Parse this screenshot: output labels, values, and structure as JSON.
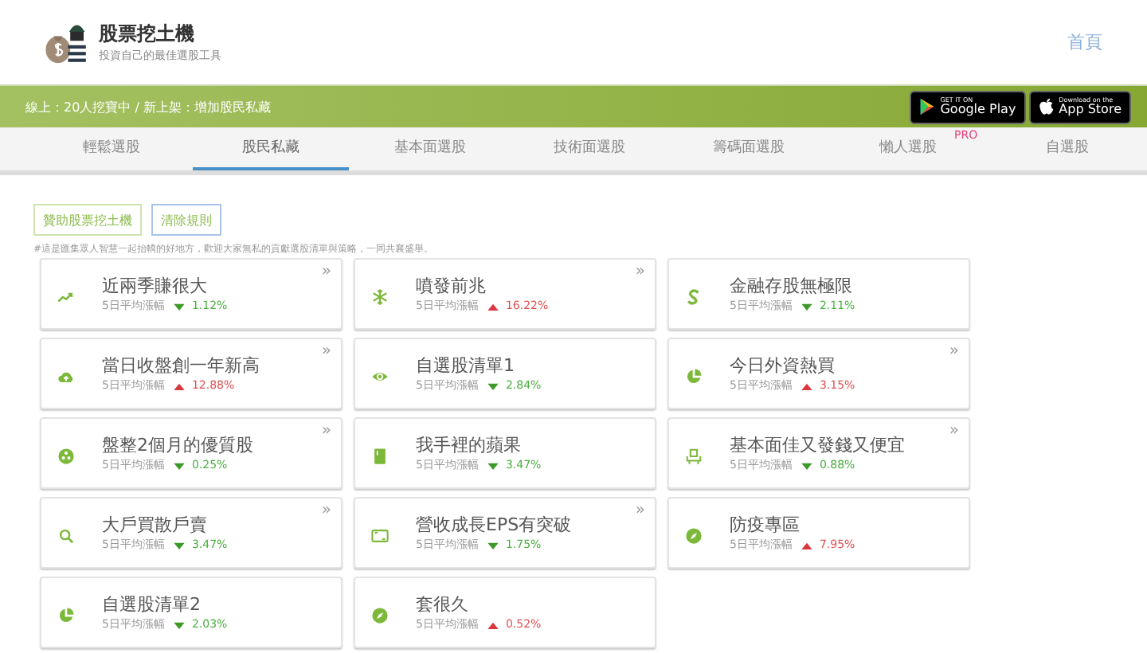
{
  "header": {
    "title": "股票挖土機",
    "subtitle": "投資自己的最佳選股工具",
    "home_link": "首頁"
  },
  "banner": {
    "text": "線上：20人挖寶中 / 新上架：增加股民私藏",
    "badges": [
      {
        "kind": "google",
        "small": "GET IT ON",
        "big": "Google Play"
      },
      {
        "kind": "apple",
        "small": "Download on the",
        "big": "App Store"
      }
    ]
  },
  "tabs": [
    {
      "label": "輕鬆選股",
      "selected": false
    },
    {
      "label": "股民私藏",
      "selected": true
    },
    {
      "label": "基本面選股",
      "selected": false
    },
    {
      "label": "技術面選股",
      "selected": false
    },
    {
      "label": "籌碼面選股",
      "selected": false
    },
    {
      "label": "懶人選股",
      "selected": false,
      "tag": "PRO"
    },
    {
      "label": "自選股",
      "selected": false
    }
  ],
  "actions": [
    {
      "label": "贊助股票挖土機",
      "kind": "sponsor"
    },
    {
      "label": "清除規則",
      "kind": "clear"
    }
  ],
  "note": "#這是匯集眾人智慧一起抬轎的好地方，歡迎大家無私的貢獻選股清單與策略，一同共襄盛舉。",
  "cards": [
    {
      "kind": "trend",
      "title": "近兩季賺很大",
      "label": "5日平均漲幅",
      "rising": false,
      "value": "1.12%",
      "more": "»"
    },
    {
      "kind": "snowflake",
      "title": "噴發前兆",
      "label": "5日平均漲幅",
      "rising": true,
      "value": "16.22%",
      "more": "»"
    },
    {
      "kind": "dollar",
      "title": "金融存股無極限",
      "label": "5日平均漲幅",
      "rising": false,
      "value": "2.11%"
    },
    {
      "kind": "cloud",
      "title": "當日收盤創一年新高",
      "label": "5日平均漲幅",
      "rising": true,
      "value": "12.88%",
      "more": "»"
    },
    {
      "kind": "eye",
      "title": "自選股清單1",
      "label": "5日平均漲幅",
      "rising": false,
      "value": "2.84%"
    },
    {
      "kind": "pie",
      "title": "今日外資熱買",
      "label": "5日平均漲幅",
      "rising": true,
      "value": "3.15%",
      "more": "»"
    },
    {
      "kind": "palette",
      "title": "盤整2個月的優質股",
      "label": "5日平均漲幅",
      "rising": false,
      "value": "0.25%",
      "more": "»"
    },
    {
      "kind": "book",
      "title": "我手裡的蘋果",
      "label": "5日平均漲幅",
      "rising": false,
      "value": "3.47%"
    },
    {
      "kind": "seat",
      "title": "基本面佳又發錢又便宜",
      "label": "5日平均漲幅",
      "rising": false,
      "value": "0.88%",
      "more": "»"
    },
    {
      "kind": "search",
      "title": "大戶買散戶賣",
      "label": "5日平均漲幅",
      "rising": false,
      "value": "3.47%",
      "more": "»"
    },
    {
      "kind": "frame",
      "title": "營收成長EPS有突破",
      "label": "5日平均漲幅",
      "rising": false,
      "value": "1.75%",
      "more": "»"
    },
    {
      "kind": "compass",
      "title": "防疫專區",
      "label": "5日平均漲幅",
      "rising": true,
      "value": "7.95%"
    },
    {
      "kind": "pie",
      "title": "自選股清單2",
      "label": "5日平均漲幅",
      "rising": false,
      "value": "2.03%"
    },
    {
      "kind": "compass",
      "title": "套很久",
      "label": "5日平均漲幅",
      "rising": true,
      "value": "0.52%"
    }
  ]
}
